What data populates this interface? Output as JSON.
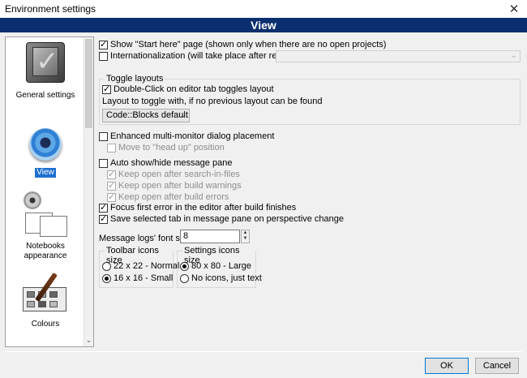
{
  "window": {
    "title": "Environment settings",
    "close_glyph": "✕"
  },
  "header": {
    "title": "View"
  },
  "sidebar": {
    "items": [
      {
        "label": "General settings",
        "icon": "general-settings-icon",
        "selected": false
      },
      {
        "label": "View",
        "icon": "view-eye-icon",
        "selected": true
      },
      {
        "label": "Notebooks\nappearance",
        "icon": "notebooks-icon",
        "selected": false
      },
      {
        "label": "Colours",
        "icon": "colours-palette-icon",
        "selected": false
      }
    ],
    "scroll_down_glyph": "⌄"
  },
  "options": {
    "show_start_here": {
      "label": "Show \"Start here\" page (shown only when there are no open projects)",
      "checked": true
    },
    "internationalization": {
      "label": "Internationalization (will take place after restart)",
      "checked": false,
      "combo_value": ""
    },
    "toggle_layouts": {
      "title": "Toggle layouts",
      "double_click": {
        "label": "Double-Click on editor tab toggles layout",
        "checked": true
      },
      "layout_to_toggle_label": "Layout to toggle with, if no previous layout can be found",
      "layout_value": "Code::Blocks default"
    },
    "multi_monitor": {
      "label": "Enhanced multi-monitor dialog placement",
      "checked": false
    },
    "head_up": {
      "label": "Move to \"head up\" position",
      "checked": false,
      "disabled": true
    },
    "auto_show_hide": {
      "label": "Auto show/hide message pane",
      "checked": false
    },
    "keep_open_search": {
      "label": "Keep open after search-in-files",
      "checked": true,
      "disabled": true
    },
    "keep_open_warnings": {
      "label": "Keep open after build warnings",
      "checked": true,
      "disabled": true
    },
    "keep_open_errors": {
      "label": "Keep open after build errors",
      "checked": true,
      "disabled": true
    },
    "focus_first_error": {
      "label": "Focus first error in the editor after build finishes",
      "checked": true
    },
    "save_selected_tab": {
      "label": "Save selected tab in message pane on perspective change",
      "checked": true
    },
    "font_size": {
      "label": "Message logs' font size:",
      "value": "8"
    },
    "toolbar_icons": {
      "title": "Toolbar icons size",
      "options": [
        {
          "label": "22 x 22 - Normal",
          "selected": false
        },
        {
          "label": "16 x 16 - Small",
          "selected": true
        }
      ]
    },
    "settings_icons": {
      "title": "Settings icons size",
      "options": [
        {
          "label": "80 x 80 - Large",
          "selected": true
        },
        {
          "label": "No icons, just text",
          "selected": false
        }
      ]
    }
  },
  "footer": {
    "ok_label": "OK",
    "cancel_label": "Cancel"
  }
}
